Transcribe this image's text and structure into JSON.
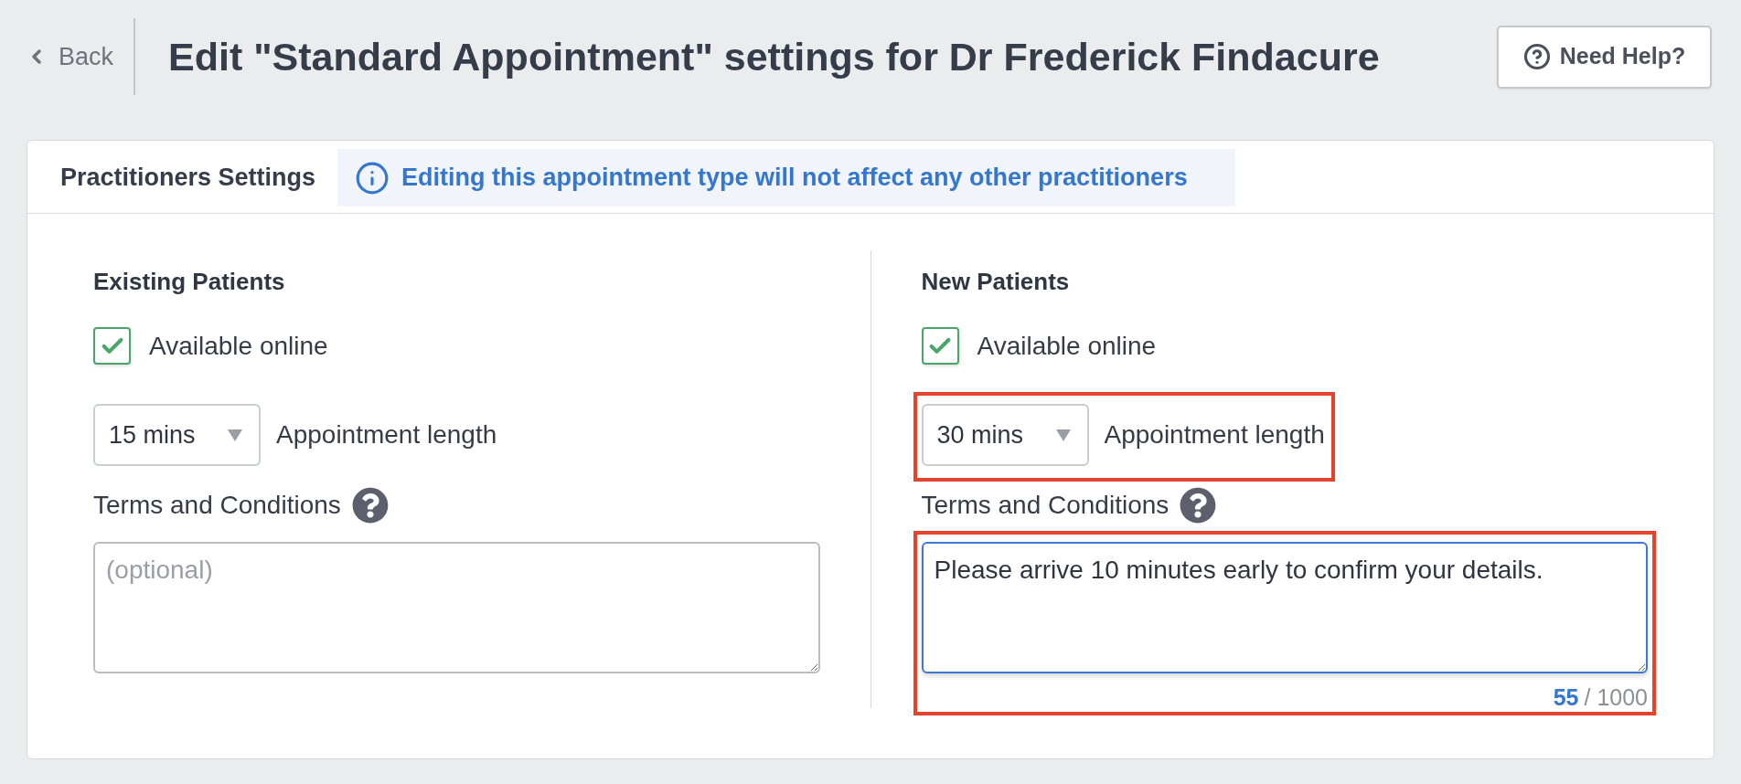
{
  "header": {
    "back_label": "Back",
    "title": "Edit \"Standard Appointment\" settings for Dr Frederick Findacure",
    "help_button": "Need Help?"
  },
  "card": {
    "title": "Practitioners Settings",
    "notice": "Editing this appointment type will not affect any other practitioners"
  },
  "sections": [
    {
      "heading": "Existing Patients",
      "available_online": {
        "label": "Available online",
        "checked": true
      },
      "appointment_length": {
        "value": "15 mins",
        "label": "Appointment length",
        "highlighted": false
      },
      "terms": {
        "label": "Terms and Conditions",
        "placeholder": "(optional)",
        "focused": false,
        "highlighted": false
      }
    },
    {
      "heading": "New Patients",
      "available_online": {
        "label": "Available online",
        "checked": true
      },
      "appointment_length": {
        "value": "30 mins",
        "label": "Appointment length",
        "highlighted": true
      },
      "terms": {
        "label": "Terms and Conditions",
        "value": "Please arrive 10 minutes early to confirm your details.",
        "counter": {
          "count": "55",
          "limit": "/ 1000"
        },
        "focused": true,
        "highlighted": true
      }
    }
  ]
}
